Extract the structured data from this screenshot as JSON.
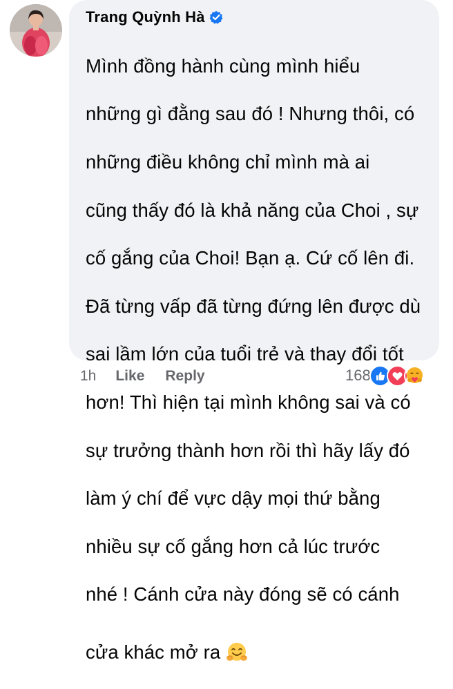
{
  "comment": {
    "author": "Trang Quỳnh Hà",
    "lines": [
      "Mình đồng hành cùng mình hiểu",
      "những gì đằng sau đó ! Nhưng thôi, có",
      "những điều không chỉ mình mà  ai",
      "cũng thấy đó là khả năng của Choi , sự",
      "cố gắng của Choi! Bạn ạ. Cứ cố lên đi.",
      "Đã từng vấp đã từng đứng lên được dù",
      "sai lầm lớn của tuổi trẻ và thay đổi tốt",
      "hơn! Thì hiện tại mình không sai và có",
      "sự trưởng thành hơn rồi thì hãy lấy đó",
      "làm ý chí để vực dậy mọi thứ bằng",
      "nhiều sự cố gắng hơn cả lúc trước",
      "nhé ! Cánh cửa này đóng sẽ có cánh",
      "cửa khác mở ra"
    ],
    "emoji": "hugging-face",
    "time": "1h",
    "like_label": "Like",
    "reply_label": "Reply",
    "reaction_count": "168",
    "reactions": [
      "like",
      "love",
      "care"
    ]
  },
  "colors": {
    "bubble": "#f0f2f5",
    "name": "#050505",
    "meta": "#65676b",
    "verified": "#1877f2",
    "like": "#1877f2",
    "love": "#f33e58",
    "care": "#f7b125"
  }
}
